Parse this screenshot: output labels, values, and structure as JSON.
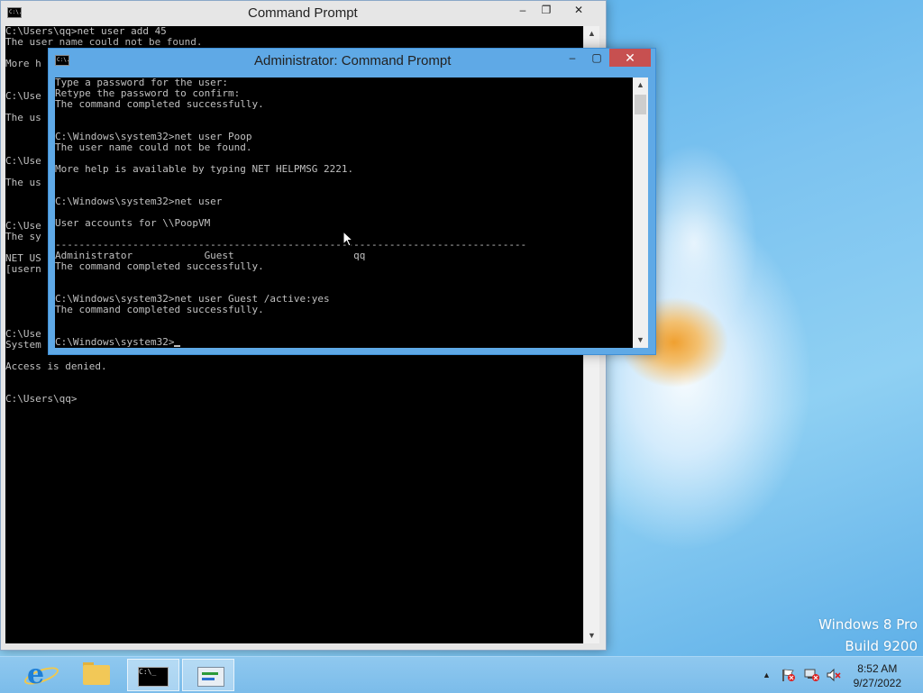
{
  "desktop": {
    "os_name": "Windows 8 Pro",
    "build": "Build 9200"
  },
  "back_window": {
    "title": "Command Prompt",
    "icon_text": "C:\\.",
    "controls": {
      "minimize": "–",
      "maximize": "❐",
      "close": "✕"
    },
    "lines": [
      "C:\\Users\\qq>net user add 45",
      "The user name could not be found.",
      "",
      "More h",
      "",
      "",
      "C:\\Use",
      "",
      "The us",
      "",
      "",
      "",
      "C:\\Use",
      "",
      "The us",
      "",
      "",
      "",
      "C:\\Use",
      "The sy",
      "",
      "NET US",
      "[usern",
      "",
      "",
      "",
      "",
      "",
      "C:\\Use",
      "System error 5 has occurred.",
      "",
      "Access is denied.",
      "",
      "",
      "C:\\Users\\qq>"
    ]
  },
  "front_window": {
    "title": "Administrator: Command Prompt",
    "icon_text": "C:\\.",
    "controls": {
      "minimize": "–",
      "maximize": "▢",
      "close": "✕"
    },
    "lines": [
      "Type a password for the user:",
      "Retype the password to confirm:",
      "The command completed successfully.",
      "",
      "",
      "C:\\Windows\\system32>net user Poop",
      "The user name could not be found.",
      "",
      "More help is available by typing NET HELPMSG 2221.",
      "",
      "",
      "C:\\Windows\\system32>net user",
      "",
      "User accounts for \\\\PoopVM",
      "",
      "-------------------------------------------------------------------------------",
      "Administrator            Guest                    qq",
      "The command completed successfully.",
      "",
      "",
      "C:\\Windows\\system32>net user Guest /active:yes",
      "The command completed successfully.",
      "",
      "",
      "C:\\Windows\\system32>"
    ]
  },
  "taskbar": {
    "cmd_icon_text": "C:\\_",
    "tray_arrow": "▲",
    "clock_time": "8:52 AM",
    "clock_date": "9/27/2022"
  },
  "icons": {
    "ie": "internet-explorer-icon",
    "explorer": "folder-icon",
    "cmd": "command-prompt-icon",
    "network": "network-icon",
    "action_center": "flag-icon",
    "sound": "speaker-muted-icon"
  }
}
